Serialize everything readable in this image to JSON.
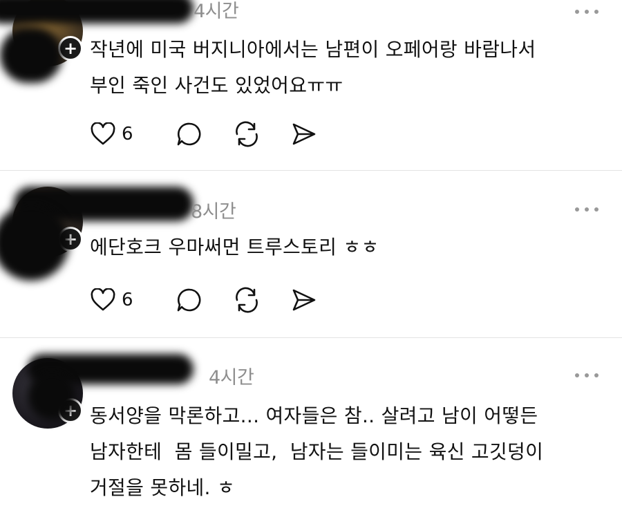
{
  "posts": [
    {
      "time": "4시간",
      "text": "작년에 미국 버지니아에서는 남편이 오페어랑 바람나서\n부인 죽인 사건도 있었어요ㅠㅠ",
      "likes": "6",
      "follow_symbol": "+"
    },
    {
      "time": "8시간",
      "text": "에단호크 우마써먼 트루스토리 ㅎㅎ",
      "likes": "6",
      "follow_symbol": "+"
    },
    {
      "time": "4시간",
      "text": "동서양을 막론하고... 여자들은 참.. 살려고 남이 어떻든\n남자한테  몸 들이밀고,  남자는 들이미는 육신 고깃덩이\n거절을 못하네. ㅎ",
      "follow_symbol": "+"
    }
  ],
  "icons": {
    "like": "heart-icon",
    "comment": "comment-bubble-icon",
    "repost": "repost-icon",
    "share": "send-icon",
    "more": "more-dots-icon"
  }
}
